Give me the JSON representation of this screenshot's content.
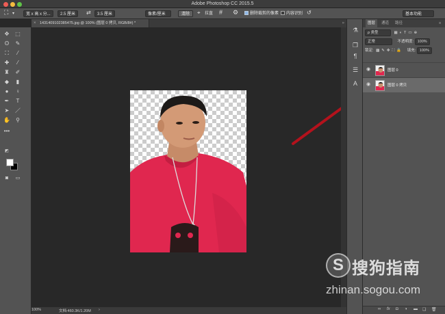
{
  "window": {
    "title": "Adobe Photoshop CC 2015.5"
  },
  "options_bar": {
    "ratio_label": "宽 x 高 x 分...",
    "width_value": "2.5 厘米",
    "swap_icon": "swap-arrows-icon",
    "height_value": "3.5 厘米",
    "unit_select": "像素/厘米",
    "clear_label": "清除",
    "straighten_label": "拉直",
    "delete_crop_label": "删除裁剪的像素",
    "content_aware_label": "内容识别",
    "workspace_label": "基本功能"
  },
  "document": {
    "tab_title": "1431409102385475.jpg @ 100% (图层 0 拷贝, RGB/8#) *"
  },
  "status_bar": {
    "zoom": "100%",
    "doc_info": "文档:460.3K/1.20M"
  },
  "layers_panel": {
    "tabs": [
      "图层",
      "通道",
      "路径"
    ],
    "filter_kind": "ρ 类型",
    "blend_mode": "正常",
    "opacity_label": "不透明度:",
    "opacity_value": "100%",
    "lock_label": "锁定:",
    "fill_label": "填充:",
    "fill_value": "100%",
    "layers": [
      {
        "name": "图层 0",
        "selected": false
      },
      {
        "name": "图层 0 拷贝",
        "selected": true
      }
    ],
    "footer_fx": "fx"
  },
  "watermark": {
    "logo_char": "S",
    "brand": "搜狗指南",
    "url": "zhinan.sogou.com"
  },
  "colors": {
    "accent_red": "#c0142a",
    "shirt_pink": "#e0274f",
    "arrow_red": "#b3121c"
  }
}
